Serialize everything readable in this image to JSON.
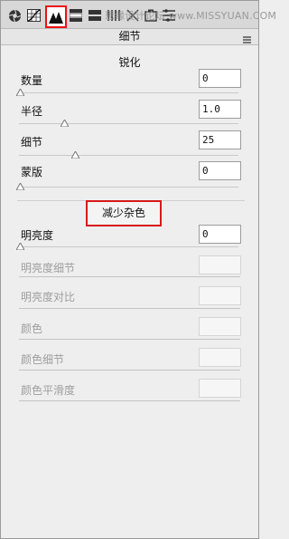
{
  "watermark": "思缘设计论坛 www.MISSYUAN.COM",
  "panel": {
    "title": "细节"
  },
  "sharpening": {
    "title": "锐化",
    "rows": [
      {
        "label": "数量",
        "value": "0",
        "level": 0
      },
      {
        "label": "半径",
        "value": "1.0",
        "level": 0.2
      },
      {
        "label": "细节",
        "value": "25",
        "level": 0.25
      },
      {
        "label": "蒙版",
        "value": "0",
        "level": 0
      }
    ]
  },
  "noise_reduction": {
    "title": "减少杂色",
    "luminance": {
      "label": "明亮度",
      "value": "0",
      "level": 0
    },
    "disabled_rows": [
      {
        "label": "明亮度细节"
      },
      {
        "label": "明亮度对比"
      },
      {
        "label": "颜色"
      },
      {
        "label": "颜色细节"
      },
      {
        "label": "颜色平滑度"
      }
    ]
  },
  "toolbar": {
    "icons": [
      "aperture-icon",
      "tone-curve-icon",
      "detail-mountains-icon",
      "hsl-icon",
      "split-toning-icon",
      "lens-icon",
      "effects-icon",
      "camera-calibration-icon",
      "presets-icon",
      "snapshots-icon"
    ]
  }
}
